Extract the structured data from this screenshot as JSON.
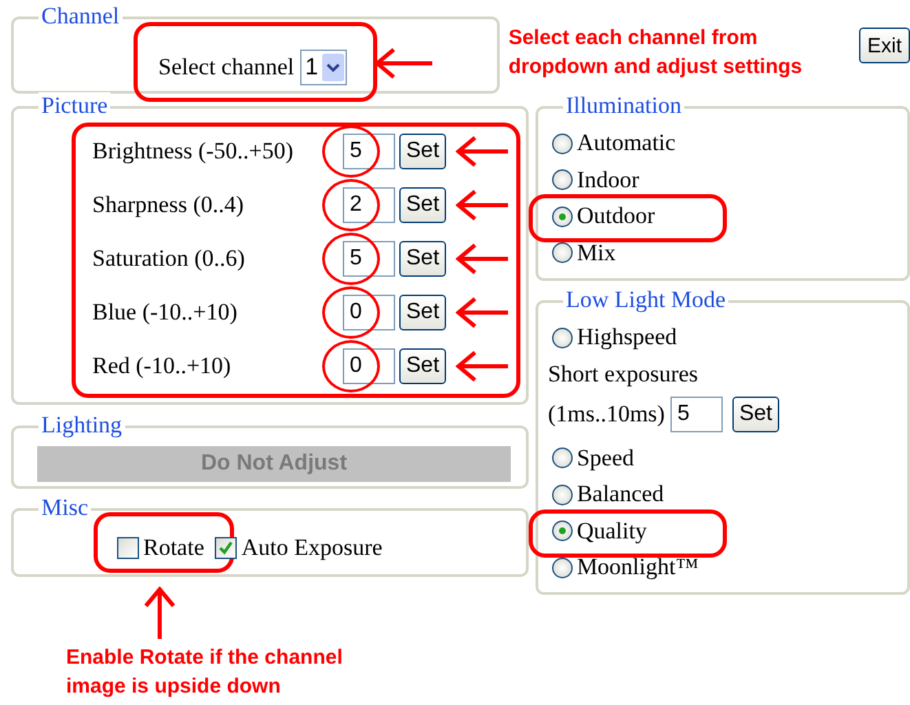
{
  "channel": {
    "title": "Channel",
    "label": "Select channel",
    "value": "1",
    "highlighted": true,
    "note": "Select each channel from dropdown and adjust settings"
  },
  "exit_button": "Exit",
  "picture": {
    "title": "Picture",
    "highlighted": true,
    "settings": [
      {
        "label": "Brightness (-50..+50)",
        "value": "5",
        "button": "Set",
        "highlighted": true
      },
      {
        "label": "Sharpness (0..4)",
        "value": "2",
        "button": "Set",
        "highlighted": true
      },
      {
        "label": "Saturation (0..6)",
        "value": "5",
        "button": "Set",
        "highlighted": true
      },
      {
        "label": "Blue (-10..+10)",
        "value": "0",
        "button": "Set",
        "highlighted": true
      },
      {
        "label": "Red (-10..+10)",
        "value": "0",
        "button": "Set",
        "highlighted": true
      }
    ]
  },
  "lighting": {
    "title": "Lighting",
    "button": "Do Not Adjust",
    "disabled": true
  },
  "misc": {
    "title": "Misc",
    "options": [
      {
        "label": "Rotate",
        "checked": false,
        "highlighted": true
      },
      {
        "label": "Auto Exposure",
        "checked": true,
        "highlighted": false
      }
    ],
    "note": "Enable Rotate if the channel image is upside down"
  },
  "illumination": {
    "title": "Illumination",
    "options": [
      {
        "label": "Automatic",
        "selected": false,
        "highlighted": false
      },
      {
        "label": "Indoor",
        "selected": false,
        "highlighted": false
      },
      {
        "label": "Outdoor",
        "selected": true,
        "highlighted": true
      },
      {
        "label": "Mix",
        "selected": false,
        "highlighted": false
      }
    ]
  },
  "low_light_mode": {
    "title": "Low Light Mode",
    "items": [
      {
        "kind": "radio",
        "label": "Highspeed",
        "selected": false,
        "highlighted": false
      },
      {
        "kind": "text",
        "label": "Short exposures"
      },
      {
        "kind": "input",
        "label": "(1ms..10ms)",
        "value": "5",
        "button": "Set"
      },
      {
        "kind": "radio",
        "label": "Speed",
        "selected": false,
        "highlighted": false
      },
      {
        "kind": "radio",
        "label": "Balanced",
        "selected": false,
        "highlighted": false
      },
      {
        "kind": "radio",
        "label": "Quality",
        "selected": true,
        "highlighted": true
      },
      {
        "kind": "radio",
        "label": "Moonlight™",
        "selected": false,
        "highlighted": false
      }
    ]
  }
}
